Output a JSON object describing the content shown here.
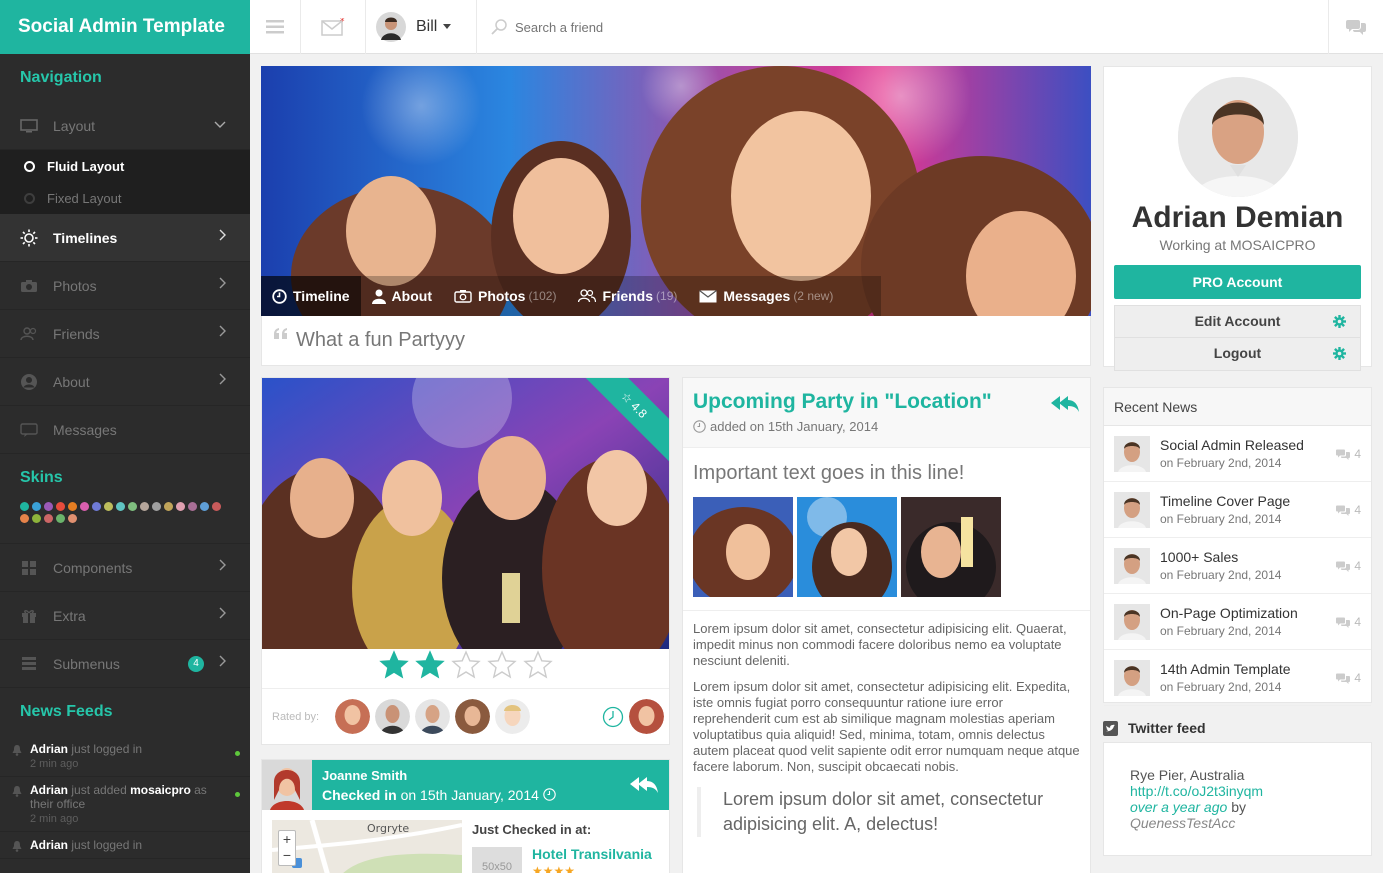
{
  "brand": "Social Admin Template",
  "sidebar": {
    "nav_heading": "Navigation",
    "layout": {
      "label": "Layout",
      "sub": [
        "Fluid Layout",
        "Fixed Layout"
      ]
    },
    "items": [
      {
        "label": "Timelines"
      },
      {
        "label": "Photos"
      },
      {
        "label": "Friends"
      },
      {
        "label": "About"
      },
      {
        "label": "Messages"
      }
    ],
    "skins_heading": "Skins",
    "skins": [
      "#1fb5a0",
      "#3aa1d7",
      "#9b59b6",
      "#e74c3c",
      "#e67e22",
      "#d95fae",
      "#6f7bd6",
      "#bdbd5c",
      "#5fc5c2",
      "#7fbf7f",
      "#b5a69b",
      "#a0a0a0",
      "#c0a45a",
      "#e0a0b0",
      "#a96f96",
      "#5f9fd8",
      "#c95b5b",
      "#e6834a",
      "#8eb43b",
      "#cc6666",
      "#6bb36b",
      "#e09070"
    ],
    "items2": [
      {
        "label": "Components"
      },
      {
        "label": "Extra"
      },
      {
        "label": "Submenus",
        "badge": "4"
      }
    ],
    "feeds_heading": "News Feeds",
    "feeds": [
      {
        "who": "Adrian",
        "text": "just logged in",
        "time": "2 min ago"
      },
      {
        "who": "Adrian",
        "text": "just added",
        "target": "mosaicpro",
        "rest": "as their office",
        "time": "2 min ago"
      },
      {
        "who": "Adrian",
        "text": "just logged in",
        "time": ""
      }
    ]
  },
  "topbar": {
    "user": "Bill",
    "search_placeholder": "Search a friend"
  },
  "cover": {
    "tabs": [
      {
        "label": "Timeline",
        "count": ""
      },
      {
        "label": "About",
        "count": ""
      },
      {
        "label": "Photos",
        "count": "(102)"
      },
      {
        "label": "Friends",
        "count": "(19)"
      },
      {
        "label": "Messages",
        "count": "(2 new)"
      }
    ]
  },
  "status": "What a fun Partyyy",
  "photo_post": {
    "rating": "4.8",
    "stars_filled": 2,
    "stars_total": 5,
    "rated_by": "Rated by:"
  },
  "checkin": {
    "name": "Joanne Smith",
    "checked": "Checked in",
    "date": "on 15th January, 2014",
    "just_checked": "Just Checked in at:",
    "thumb": "50x50",
    "hotel": "Hotel Transilvania",
    "map_street": "Orgryte"
  },
  "party": {
    "title": "Upcoming Party in \"Location\"",
    "date": "added on 15th January, 2014",
    "important": "Important text goes in this line!",
    "p1": "Lorem ipsum dolor sit amet, consectetur adipisicing elit. Quaerat, impedit minus non commodi facere doloribus nemo ea voluptate nesciunt deleniti.",
    "p2": "Lorem ipsum dolor sit amet, consectetur adipisicing elit. Expedita, iste omnis fugiat porro consequuntur ratione iure error reprehenderit cum est ab similique magnam molestias aperiam voluptatibus quia aliquid! Sed, minima, totam, omnis delectus autem placeat quod velit sapiente odit error numquam neque atque facere laborum. Non, suscipit obcaecati nobis.",
    "quote": "Lorem ipsum dolor sit amet, consectetur adipisicing elit. A, delectus!"
  },
  "profile": {
    "name": "Adrian Demian",
    "job": "Working at MOSAICPRO",
    "pro": "PRO Account",
    "edit": "Edit Account",
    "logout": "Logout"
  },
  "news": {
    "title": "Recent News",
    "items": [
      {
        "title": "Social Admin Released",
        "date": "on February 2nd, 2014",
        "count": "4"
      },
      {
        "title": "Timeline Cover Page",
        "date": "on February 2nd, 2014",
        "count": "4"
      },
      {
        "title": "1000+ Sales",
        "date": "on February 2nd, 2014",
        "count": "4"
      },
      {
        "title": "On-Page Optimization",
        "date": "on February 2nd, 2014",
        "count": "4"
      },
      {
        "title": "14th Admin Template",
        "date": "on February 2nd, 2014",
        "count": "4"
      }
    ]
  },
  "twitter": {
    "title": "Twitter feed",
    "location": "Rye Pier, Australia",
    "link": "http://t.co/oJ2t3inyqm",
    "when": "over a year ago",
    "by": "by",
    "account": "QuenessTestAcc"
  },
  "colors": {
    "accent": "#1fb5a0",
    "sidebar": "#2c2c2c",
    "orange_star": "#f6a623"
  }
}
